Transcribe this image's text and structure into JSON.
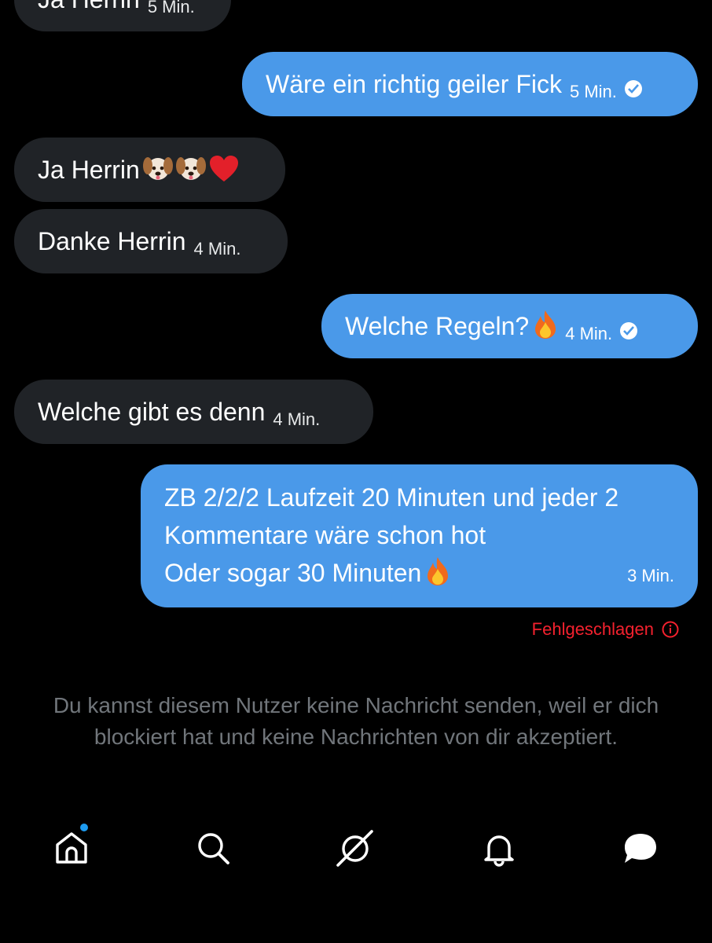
{
  "messages": [
    {
      "text": "Ja Herrin",
      "time": "5 Min."
    },
    {
      "text": "Wäre ein richtig geiler Fick",
      "time": "5 Min."
    },
    {
      "text": "Ja Herrin",
      "time": ""
    },
    {
      "text": "Danke Herrin",
      "time": "4 Min."
    },
    {
      "text": "Welche Regeln?",
      "time": "4 Min."
    },
    {
      "text": "Welche gibt es denn",
      "time": "4 Min."
    },
    {
      "lines": [
        "ZB 2/2/2 Laufzeit 20 Minuten und jeder 2",
        "Kommentare wäre schon hot",
        "Oder sogar 30 Minuten"
      ],
      "time": "3 Min."
    }
  ],
  "failed_label": "Fehlgeschlagen",
  "blocked_notice": "Du kannst diesem Nutzer keine Nachricht senden, weil er dich blockiert hat und keine Nachrichten von dir akzeptiert.",
  "colors": {
    "outgoing": "#4a99e9",
    "incoming": "#202327",
    "error": "#f4212e",
    "muted": "#71767b",
    "badge": "#1d9bf0"
  },
  "nav_icons": [
    "home-icon",
    "search-icon",
    "grok-icon",
    "notifications-icon",
    "messages-icon"
  ]
}
